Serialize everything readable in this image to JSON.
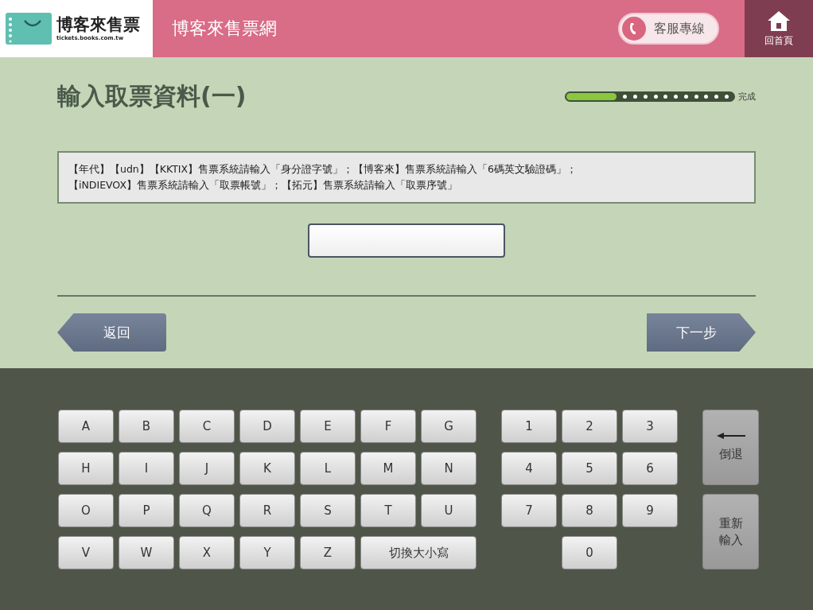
{
  "header": {
    "logo_text": "博客來售票",
    "logo_url": "tickets.books.com.tw",
    "site_title": "博客來售票網",
    "hotline_button": "客服專線",
    "home_button": "回首頁"
  },
  "page_title": "輸入取票資料(一)",
  "progress": {
    "level": 0.3,
    "label": "完成"
  },
  "instructions": [
    "【年代】【udn】【KKTIX】售票系統請輸入「身分證字號」；【博客來】售票系統請輸入「6碼英文驗證碼」；",
    "【iNDIEVOX】售票系統請輸入「取票帳號」；【拓元】售票系統請輸入「取票序號」"
  ],
  "back_button": "返回",
  "next_button": "下一步",
  "keyboard": {
    "letter_keys": [
      "A",
      "B",
      "C",
      "D",
      "E",
      "F",
      "G",
      "H",
      "I",
      "J",
      "K",
      "L",
      "M",
      "N",
      "O",
      "P",
      "Q",
      "R",
      "S",
      "T",
      "U",
      "V",
      "W",
      "X",
      "Y",
      "Z"
    ],
    "case_key": "切換大小寫",
    "number_keys": [
      "1",
      "2",
      "3",
      "4",
      "5",
      "6",
      "7",
      "8",
      "9",
      "0"
    ],
    "backspace_key": "倒退",
    "reset_key": "重新輸入"
  }
}
